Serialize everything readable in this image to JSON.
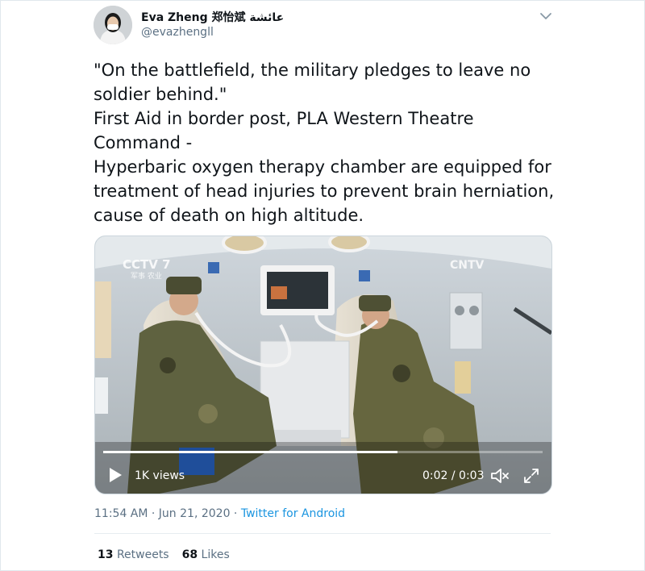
{
  "tweet": {
    "author_name": "Eva Zheng 郑怡斌 عائشة",
    "handle": "@evazhengll",
    "text_lines": [
      "\"On the battlefield, the military pledges to leave no",
      "soldier behind.\"",
      "First Aid in border post, PLA Western Theatre",
      "Command -",
      "Hyperbaric oxygen therapy chamber are equipped for",
      "treatment of head injuries to prevent brain herniation,",
      "cause of death on high altitude."
    ],
    "timestamp": "11:54 AM · Jun 21, 2020",
    "separator": " · ",
    "source": "Twitter for Android",
    "retweets_count": "13",
    "retweets_label": "Retweets",
    "likes_count": "68",
    "likes_label": "Likes"
  },
  "video": {
    "views": "1K views",
    "time": "0:02 / 0:03",
    "progress_fraction": 0.67,
    "watermark_left": "CCTV 7",
    "watermark_left_sub": "军事 农业",
    "watermark_right": "CNTV"
  },
  "icons": {
    "more": "chevron-down-icon",
    "play": "play-icon",
    "volume": "volume-muted-icon",
    "fullscreen": "fullscreen-icon"
  },
  "colors": {
    "link": "#1b95e0",
    "muted": "#5b7083",
    "text": "#0f1419"
  }
}
